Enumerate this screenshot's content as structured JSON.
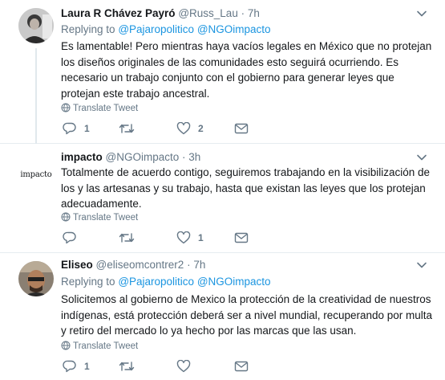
{
  "tweets": [
    {
      "name": "Laura R Chávez Payró",
      "handle": "@Russ_Lau",
      "sep": "·",
      "time": "7h",
      "reply_prefix": "Replying to",
      "reply_handles": "@Pajaropolitico @NGOimpacto",
      "text": "Es lamentable! Pero mientras haya vacíos legales en México que no protejan los diseños originales de las comunidades esto seguirá ocurriendo. Es necesario un trabajo conjunto con el gobierno para generar leyes que protejan este trabajo ancestral.",
      "translate": "Translate Tweet",
      "replies": "1",
      "retweets": "",
      "likes": "2"
    },
    {
      "name": "impacto",
      "handle": "@NGOimpacto",
      "sep": "·",
      "time": "3h",
      "avatar_text": "impacto",
      "text": "Totalmente de acuerdo contigo, seguiremos trabajando en la visibilización de los y las artesanas y su trabajo, hasta que existan las leyes que los protejan adecuadamente.",
      "translate": "Translate Tweet",
      "replies": "",
      "retweets": "",
      "likes": "1"
    },
    {
      "name": "Eliseo",
      "handle": "@eliseomcontrer2",
      "sep": "·",
      "time": "7h",
      "reply_prefix": "Replying to",
      "reply_handles": "@Pajaropolitico @NGOimpacto",
      "text": "Solicitemos al gobierno de Mexico la protección de la creatividad de nuestros indígenas, está protección deberá ser a nivel mundial, recuperando por multa y retiro del mercado lo ya hecho por las marcas que las usan.",
      "translate": "Translate Tweet",
      "replies": "1",
      "retweets": "",
      "likes": ""
    }
  ],
  "colors": {
    "accent": "#1b95e0",
    "muted": "#657786",
    "text": "#14171a",
    "border": "#e6ecf0"
  },
  "icons": [
    "reply-icon",
    "retweet-icon",
    "like-icon",
    "message-icon",
    "globe-icon",
    "chevron-down-icon"
  ]
}
